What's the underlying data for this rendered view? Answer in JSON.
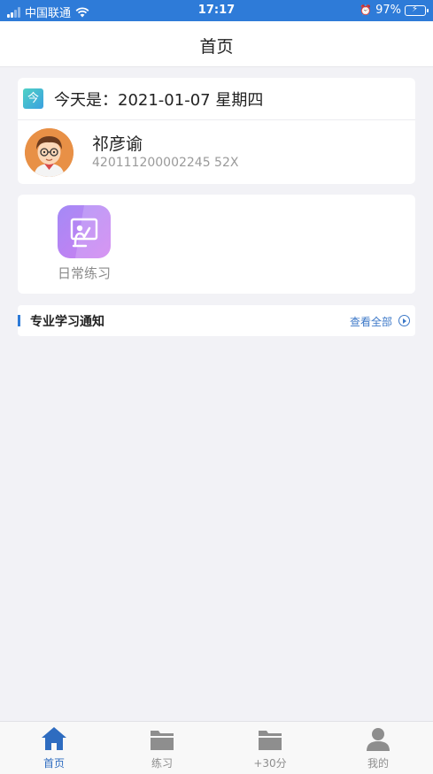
{
  "status_bar": {
    "carrier": "中国联通",
    "time": "17:17",
    "battery": "97%",
    "battery_level": 0.97
  },
  "nav": {
    "title": "首页"
  },
  "date_row": {
    "icon_char": "今",
    "text": "今天是：2021-01-07 星期四"
  },
  "user": {
    "name": "祁彦谕",
    "id_number": "420111200002245 52X"
  },
  "apps": [
    {
      "label": "日常练习",
      "icon": "whiteboard-icon"
    }
  ],
  "notice": {
    "title": "专业学习通知",
    "more": "查看全部"
  },
  "tabs": [
    {
      "label": "首页",
      "icon": "home-icon",
      "active": true
    },
    {
      "label": "练习",
      "icon": "folder-icon",
      "active": false
    },
    {
      "label": "+30分",
      "icon": "folder-icon",
      "active": false
    },
    {
      "label": "我的",
      "icon": "person-icon",
      "active": false
    }
  ],
  "colors": {
    "primary": "#2e7bd8",
    "tab_active": "#2e6cc0",
    "tab_inactive": "#8e8e8e",
    "app_gradient_start": "#a48af6",
    "app_gradient_end": "#cf7ef0"
  }
}
